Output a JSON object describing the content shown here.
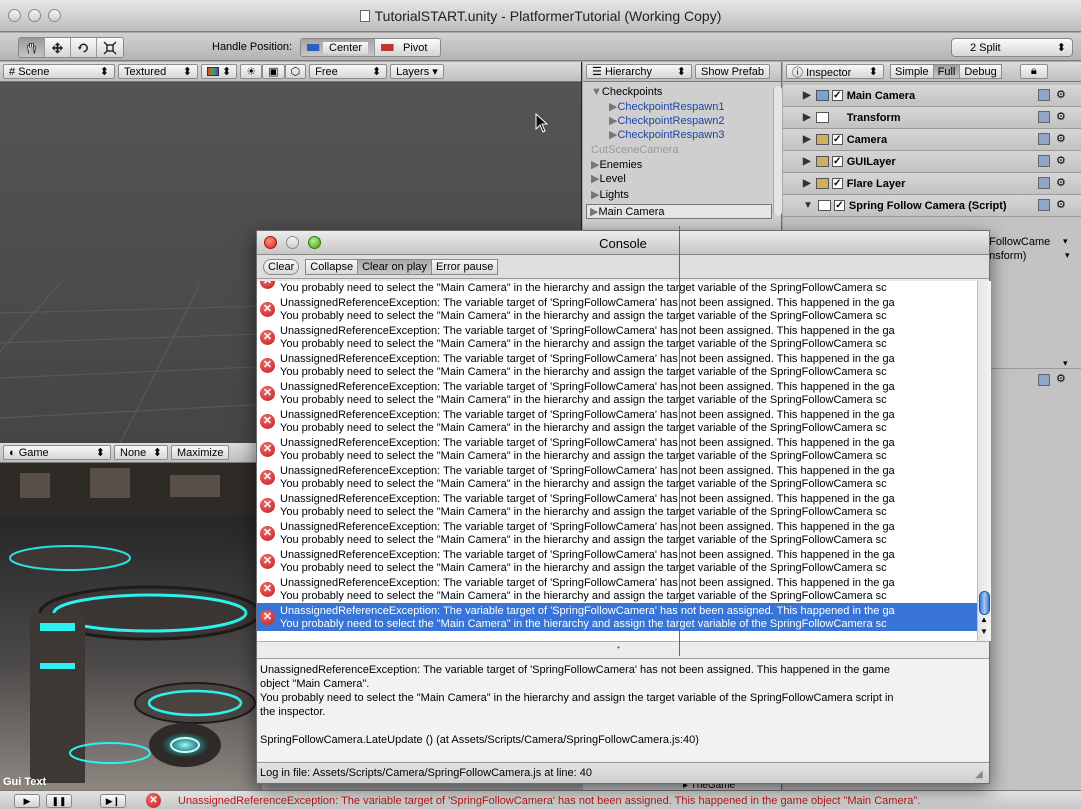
{
  "window": {
    "title": "TutorialSTART.unity - PlatformerTutorial (Working Copy)"
  },
  "toolbar": {
    "handle_position_label": "Handle Position:",
    "center": "Center",
    "pivot": "Pivot",
    "layout": "2 Split"
  },
  "scene": {
    "tab": "Scene",
    "mode": "Textured",
    "free": "Free",
    "layers": "Layers"
  },
  "game": {
    "tab": "Game",
    "aspect": "None",
    "maximize": "Maximize",
    "gui_text": "Gui Text"
  },
  "hierarchy": {
    "tab": "Hierarchy",
    "show_prefab": "Show Prefab",
    "items": [
      {
        "label": "Checkpoints",
        "level": 0,
        "open": true
      },
      {
        "label": "CheckpointRespawn1",
        "level": 1,
        "prefab": true
      },
      {
        "label": "CheckpointRespawn2",
        "level": 1,
        "prefab": true
      },
      {
        "label": "CheckpointRespawn3",
        "level": 1,
        "prefab": true
      },
      {
        "label": "CutSceneCamera",
        "level": 0,
        "inactive": true
      },
      {
        "label": "Enemies",
        "level": 0
      },
      {
        "label": "Level",
        "level": 0
      },
      {
        "label": "Lights",
        "level": 0
      },
      {
        "label": "Main Camera",
        "level": 0,
        "selected": true
      }
    ],
    "bottom_item": "TheGame"
  },
  "inspector": {
    "tab": "Inspector",
    "simple": "Simple",
    "full": "Full",
    "debug": "Debug",
    "components": [
      "Main Camera",
      "Transform",
      "Camera",
      "GUILayer",
      "Flare Layer",
      "Spring Follow Camera (Script)"
    ],
    "field_fragment_1": "gFollowCame",
    "field_fragment_2": "ansform)"
  },
  "console": {
    "title": "Console",
    "clear": "Clear",
    "collapse": "Collapse",
    "clear_on_play": "Clear on play",
    "error_pause": "Error pause",
    "line1": "UnassignedReferenceException: The variable target of 'SpringFollowCamera' has not been assigned. This happened in the ga",
    "line2": "You probably need to select the \"Main Camera\" in the hierarchy and assign the target variable of the SpringFollowCamera sc",
    "detail_1": "UnassignedReferenceException: The variable target of 'SpringFollowCamera' has not been assigned. This happened in the game",
    "detail_2": "object \"Main Camera\".",
    "detail_3": "You probably need to select the \"Main Camera\" in the hierarchy and assign the target variable of the SpringFollowCamera script in",
    "detail_4": "the inspector.",
    "detail_5": "SpringFollowCamera.LateUpdate ()  (at Assets/Scripts/Camera/SpringFollowCamera.js:40)",
    "status": "Log in file: Assets/Scripts/Camera/SpringFollowCamera.js at line: 40",
    "entry_count": 13
  },
  "statusbar": {
    "message": "UnassignedReferenceException: The variable target of 'SpringFollowCamera' has not been assigned. This happened in the game object \"Main Camera\"."
  },
  "colors": {
    "selection": "#3875d7",
    "error": "#c01818",
    "status_error_text": "#b81a1a"
  }
}
